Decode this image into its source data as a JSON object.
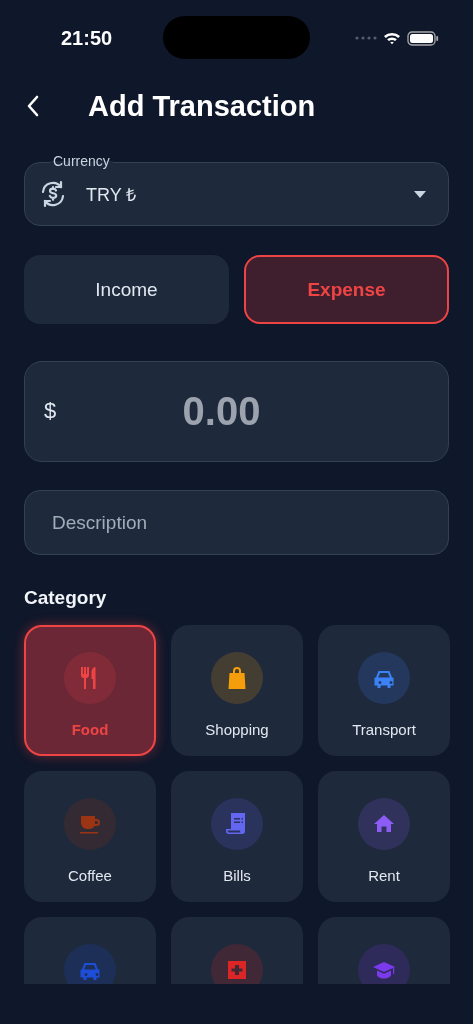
{
  "status_bar": {
    "time": "21:50"
  },
  "header": {
    "title": "Add Transaction"
  },
  "currency": {
    "label": "Currency",
    "value": "TRY ₺"
  },
  "type_toggle": [
    {
      "label": "Income",
      "selected": false
    },
    {
      "label": "Expense",
      "selected": true
    }
  ],
  "amount": {
    "prefix": "$",
    "placeholder": "0.00"
  },
  "description": {
    "placeholder": "Description"
  },
  "category_title": "Category",
  "categories": [
    {
      "label": "Food",
      "kind": "fork-knife",
      "color": "#ef4444",
      "selected": true
    },
    {
      "label": "Shopping",
      "kind": "bag",
      "color": "#f59e0b",
      "selected": false
    },
    {
      "label": "Transport",
      "kind": "car",
      "color": "#3b82f6",
      "selected": false
    },
    {
      "label": "Coffee",
      "kind": "cup",
      "color": "#9a3412",
      "selected": false
    },
    {
      "label": "Bills",
      "kind": "receipt",
      "color": "#6366f1",
      "selected": false
    },
    {
      "label": "Rent",
      "kind": "house",
      "color": "#8b5cf6",
      "selected": false
    },
    {
      "kind": "car",
      "color": "#1d4ed8",
      "selected": false
    },
    {
      "kind": "medical",
      "color": "#dc2626",
      "selected": false
    },
    {
      "kind": "graduation-cap",
      "color": "#7c3aed",
      "selected": false
    }
  ]
}
